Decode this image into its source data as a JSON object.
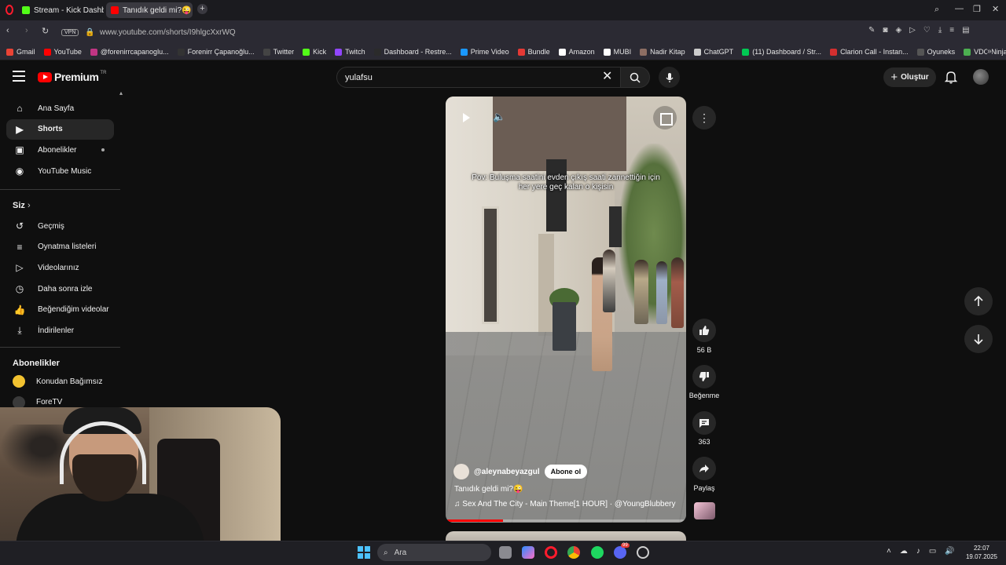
{
  "browser": {
    "tabs": [
      {
        "label": "Stream - Kick Dashboard",
        "icon": "kick-icon",
        "color": "#53fc18"
      },
      {
        "label": "Tanıdık geldi mi?😜",
        "icon": "youtube-icon",
        "color": "#ff0000"
      }
    ],
    "vpn": "VPN",
    "url": "www.youtube.com/shorts/I9hlgcXxrWQ",
    "bookmarks": [
      {
        "label": "Gmail",
        "color": "#ea4335"
      },
      {
        "label": "YouTube",
        "color": "#ff0000"
      },
      {
        "label": "@forenirrcapanoglu...",
        "color": "#c13584"
      },
      {
        "label": "Forenirr Çapanoğlu...",
        "color": "#333333"
      },
      {
        "label": "Twitter",
        "color": "#444444"
      },
      {
        "label": "Kick",
        "color": "#53fc18"
      },
      {
        "label": "Twitch",
        "color": "#9146ff"
      },
      {
        "label": "Dashboard - Restre...",
        "color": "#2b2b2b"
      },
      {
        "label": "Prime Video",
        "color": "#1a98ff"
      },
      {
        "label": "Bundle",
        "color": "#e53935"
      },
      {
        "label": "Amazon",
        "color": "#ffffff"
      },
      {
        "label": "MUBI",
        "color": "#ffffff"
      },
      {
        "label": "Nadir Kitap",
        "color": "#8d6e63"
      },
      {
        "label": "ChatGPT",
        "color": "#cccccc"
      },
      {
        "label": "(11) Dashboard / Str...",
        "color": "#00c853"
      },
      {
        "label": "Clarion Call - Instan...",
        "color": "#d32f2f"
      },
      {
        "label": "Oyuneks",
        "color": "#555555"
      },
      {
        "label": "VDO.Ninja",
        "color": "#4caf50"
      }
    ]
  },
  "youtube": {
    "logo": "Premium",
    "logo_region": "TR",
    "search_value": "yulafsu",
    "create_label": "Oluştur",
    "nav_main": [
      {
        "label": "Ana Sayfa",
        "icon": "home-icon"
      },
      {
        "label": "Shorts",
        "icon": "shorts-icon"
      },
      {
        "label": "Abonelikler",
        "icon": "subscriptions-icon"
      },
      {
        "label": "YouTube Music",
        "icon": "youtube-music-icon"
      }
    ],
    "section_you": "Siz",
    "nav_you": [
      {
        "label": "Geçmiş",
        "icon": "history-icon"
      },
      {
        "label": "Oynatma listeleri",
        "icon": "playlists-icon"
      },
      {
        "label": "Videolarınız",
        "icon": "your-videos-icon"
      },
      {
        "label": "Daha sonra izle",
        "icon": "watch-later-icon"
      },
      {
        "label": "Beğendiğim videolar",
        "icon": "liked-videos-icon"
      },
      {
        "label": "İndirilenler",
        "icon": "downloads-icon"
      }
    ],
    "section_subs": "Abonelikler",
    "subscriptions": [
      {
        "label": "Konudan Bağımsız"
      },
      {
        "label": "ForeTV"
      }
    ]
  },
  "short": {
    "caption": "Pov: Buluşma saatini evden çıkış saati zannettiğin için her yere geç kalan o kişisin",
    "channel": "@aleynabeyazgul",
    "subscribe": "Abone ol",
    "title": "Tanıdık geldi mi?😜",
    "music": "♫ Sex And The City - Main Theme[1 HOUR] · @YoungBlubbery",
    "progress": 0.24,
    "likes": "56 B",
    "dislike_label": "Beğenme",
    "comments": "363",
    "share_label": "Paylaş"
  },
  "taskbar": {
    "search_placeholder": "Ara",
    "time": "22:07",
    "date": "19.07.2025",
    "discord_badge": "99"
  }
}
